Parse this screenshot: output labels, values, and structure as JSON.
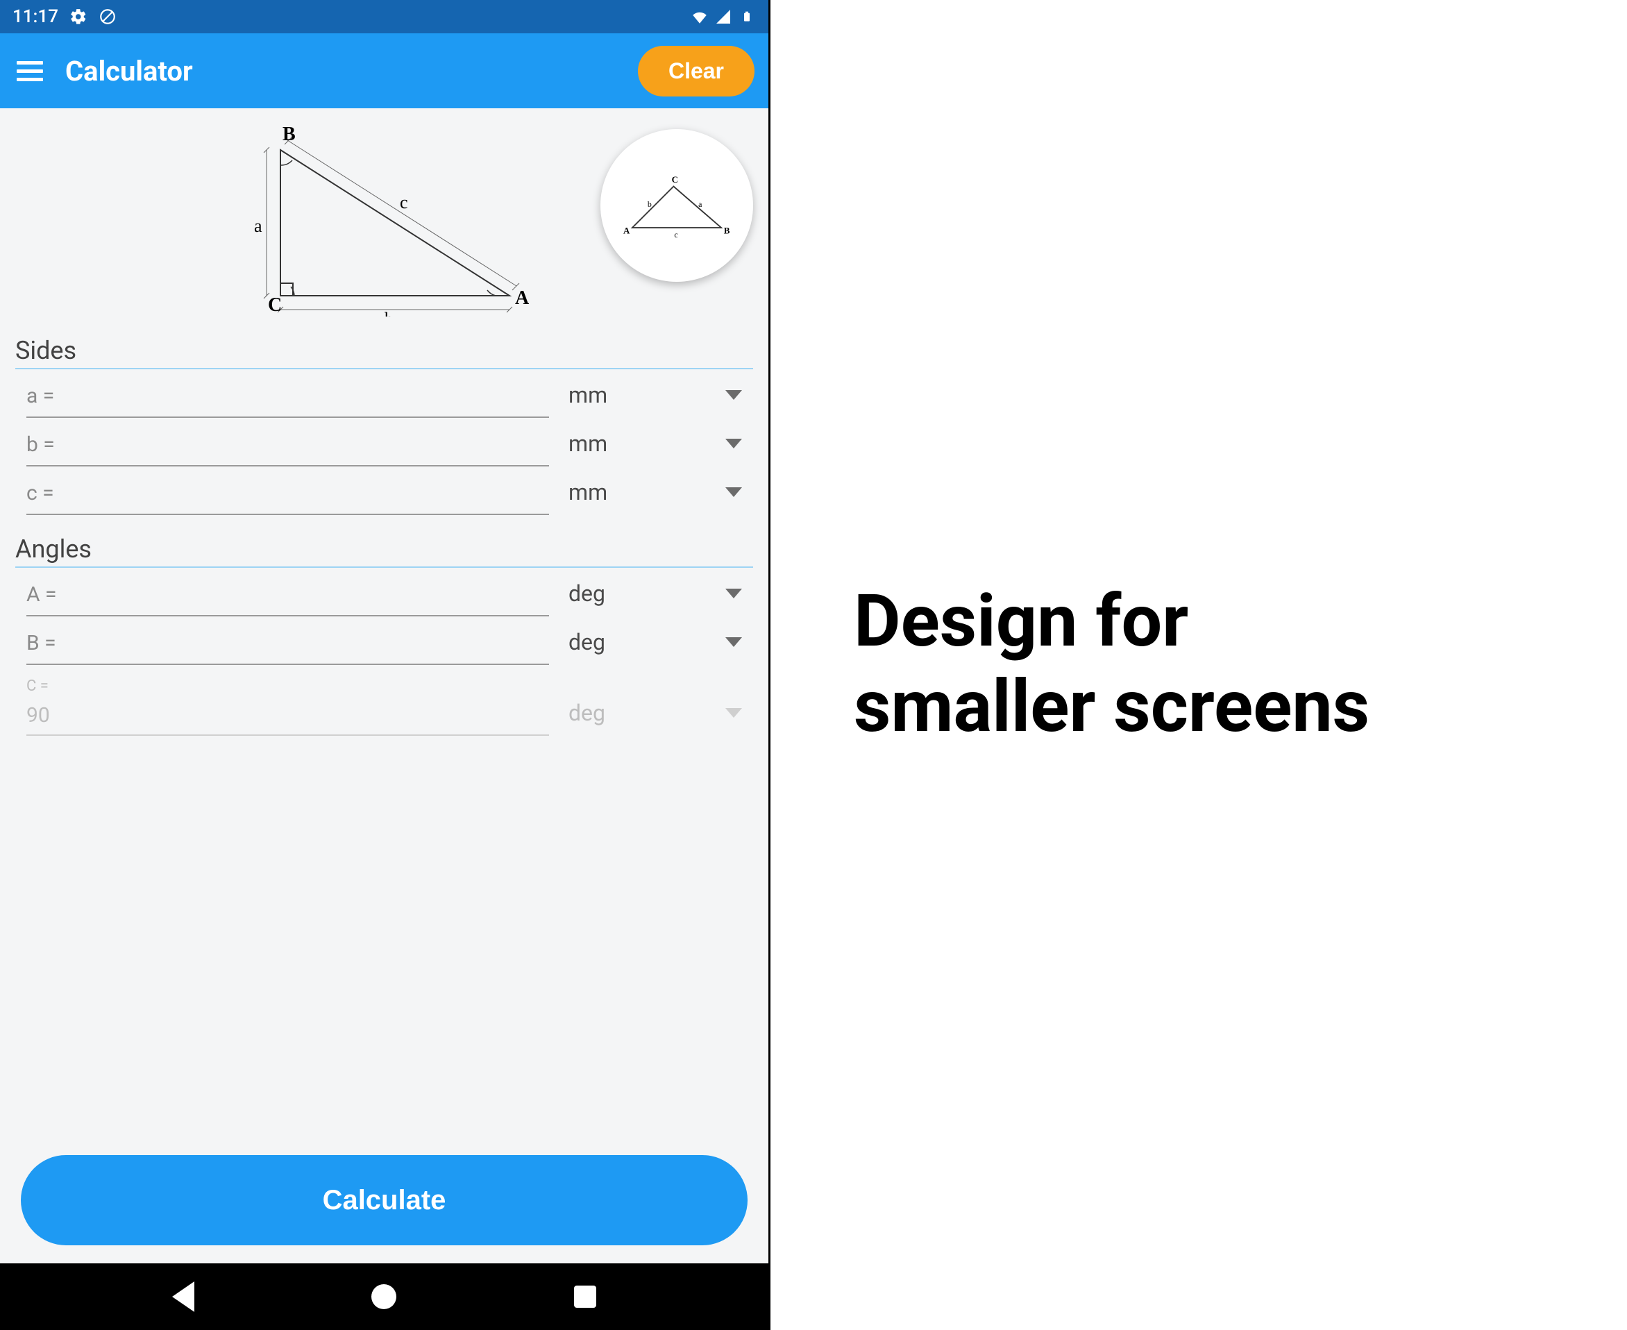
{
  "statusbar": {
    "time": "11:17"
  },
  "appbar": {
    "title": "Calculator",
    "clear": "Clear"
  },
  "sections": {
    "sides": "Sides",
    "angles": "Angles"
  },
  "fields": {
    "a": {
      "label": "a =",
      "unit": "mm"
    },
    "b": {
      "label": "b =",
      "unit": "mm"
    },
    "c": {
      "label": "c =",
      "unit": "mm"
    },
    "A": {
      "label": "A =",
      "unit": "deg"
    },
    "B": {
      "label": "B =",
      "unit": "deg"
    },
    "C": {
      "label": "C =",
      "value": "90",
      "unit": "deg"
    }
  },
  "diagram": {
    "main_labels": {
      "A": "A",
      "B": "B",
      "C": "C",
      "a": "a",
      "b": "b",
      "c": "c"
    },
    "alt_labels": {
      "A": "A",
      "B": "B",
      "C": "C",
      "a": "a",
      "b": "b",
      "c": "c"
    }
  },
  "calculate": "Calculate",
  "side_text_line1": "Design for",
  "side_text_line2": "smaller screens"
}
